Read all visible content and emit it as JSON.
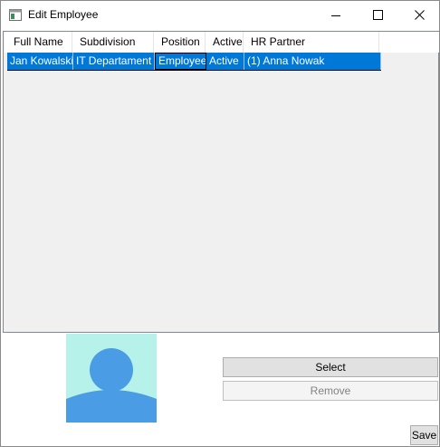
{
  "window": {
    "title": "Edit Employee"
  },
  "grid": {
    "columns": [
      "Full Name",
      "Subdivision",
      "Position",
      "Active",
      "HR Partner"
    ],
    "rows": [
      {
        "full_name": "Jan Kowalski",
        "subdivision": "IT Departament",
        "position": "Employee",
        "active": "Active",
        "hr_partner": "(1) Anna Nowak"
      }
    ]
  },
  "photo": {
    "icon": "user-avatar-icon",
    "background": "#b7f2ea",
    "figure": "#4a9de4"
  },
  "buttons": {
    "select": "Select",
    "remove": "Remove",
    "save": "Save"
  },
  "colors": {
    "selection": "#0078d7",
    "grid_background": "#f0f0f0"
  }
}
